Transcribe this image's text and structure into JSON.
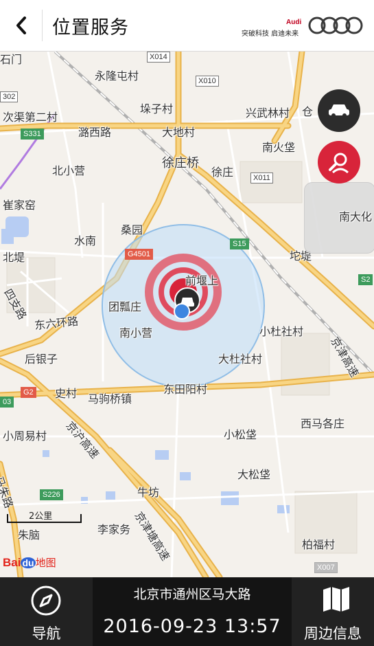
{
  "header": {
    "title": "位置服务",
    "brand_name": "Audi",
    "brand_slogan": "突破科技 启迪未来",
    "back_icon": "chevron-left-icon",
    "logo": "audi-rings-logo"
  },
  "map": {
    "place_labels": [
      {
        "id": "shitian",
        "text": "石门"
      },
      {
        "id": "yonglongtun",
        "text": "永隆屯村"
      },
      {
        "id": "cicu",
        "text": "次渠第二村"
      },
      {
        "id": "duozi",
        "text": "垛子村"
      },
      {
        "id": "xingwulin",
        "text": "兴武林村"
      },
      {
        "id": "cang",
        "text": "仓"
      },
      {
        "id": "luxilu",
        "text": "潞西路"
      },
      {
        "id": "dadi",
        "text": "大地村"
      },
      {
        "id": "nanhuobao",
        "text": "南火垡"
      },
      {
        "id": "beixiaoying",
        "text": "北小营"
      },
      {
        "id": "xuzhuangqiao",
        "text": "徐庄桥"
      },
      {
        "id": "xuzhuang",
        "text": "徐庄"
      },
      {
        "id": "cuijiayao",
        "text": "崔家窑"
      },
      {
        "id": "nandahua",
        "text": "南大化"
      },
      {
        "id": "shuinan",
        "text": "水南"
      },
      {
        "id": "sangyuan",
        "text": "桑园"
      },
      {
        "id": "beidi",
        "text": "北堤"
      },
      {
        "id": "tuoji",
        "text": "坨堤"
      },
      {
        "id": "qianyangshang",
        "text": "前堰上"
      },
      {
        "id": "tuanpiaozhuang",
        "text": "团瓢庄"
      },
      {
        "id": "sizhilu",
        "text": "四支路"
      },
      {
        "id": "dongliuhuan",
        "text": "东六环路"
      },
      {
        "id": "nanxiaoying",
        "text": "南小营"
      },
      {
        "id": "xiaodushe",
        "text": "小杜社村"
      },
      {
        "id": "jingjingao",
        "text": "京津高速"
      },
      {
        "id": "houyinzi",
        "text": "后银子"
      },
      {
        "id": "dadushe",
        "text": "大杜社村"
      },
      {
        "id": "shicun",
        "text": "史村"
      },
      {
        "id": "majuqiao",
        "text": "马驹桥镇"
      },
      {
        "id": "dongtianyang",
        "text": "东田阳村"
      },
      {
        "id": "xiaozhouyi",
        "text": "小周易村"
      },
      {
        "id": "jinghugao",
        "text": "京沪高速"
      },
      {
        "id": "xiaosongbao",
        "text": "小松垡"
      },
      {
        "id": "ximage",
        "text": "西马各庄"
      },
      {
        "id": "dasongbao",
        "text": "大松垡"
      },
      {
        "id": "mazhulu",
        "text": "马朱路"
      },
      {
        "id": "niufang",
        "text": "牛坊"
      },
      {
        "id": "zhuqiao",
        "text": "朱脑"
      },
      {
        "id": "lijiawu",
        "text": "李家务"
      },
      {
        "id": "jingjintang",
        "text": "京津塘高速"
      },
      {
        "id": "baifu",
        "text": "柏福村"
      }
    ],
    "road_shields": [
      {
        "id": "x014",
        "text": "X014"
      },
      {
        "id": "x010",
        "text": "X010"
      },
      {
        "id": "s302",
        "text": "302"
      },
      {
        "id": "s331",
        "text": "S331"
      },
      {
        "id": "x011",
        "text": "X011"
      },
      {
        "id": "g4501",
        "text": "G4501"
      },
      {
        "id": "s15",
        "text": "S15"
      },
      {
        "id": "s22",
        "text": "S2"
      },
      {
        "id": "g2",
        "text": "G2"
      },
      {
        "id": "l03",
        "text": "03"
      },
      {
        "id": "s226",
        "text": "S226"
      },
      {
        "id": "x007",
        "text": "X007"
      }
    ],
    "scale_label": "2公里",
    "provider_logo_text": "Baidu地图",
    "car_fab_icon": "car-icon",
    "search_fab_icon": "person-search-icon",
    "location_marker_icon": "car-location-marker-icon",
    "colors": {
      "accent": "#d8243a",
      "highway": "#f5c45e",
      "water": "#b7cdf3",
      "accuracy": "#a6ccf2"
    }
  },
  "footer": {
    "nav_label": "导航",
    "nav_icon": "compass-icon",
    "address": "北京市通州区马大路",
    "datetime": "2016-09-23 13:57",
    "around_label": "周边信息",
    "around_icon": "map-icon"
  }
}
